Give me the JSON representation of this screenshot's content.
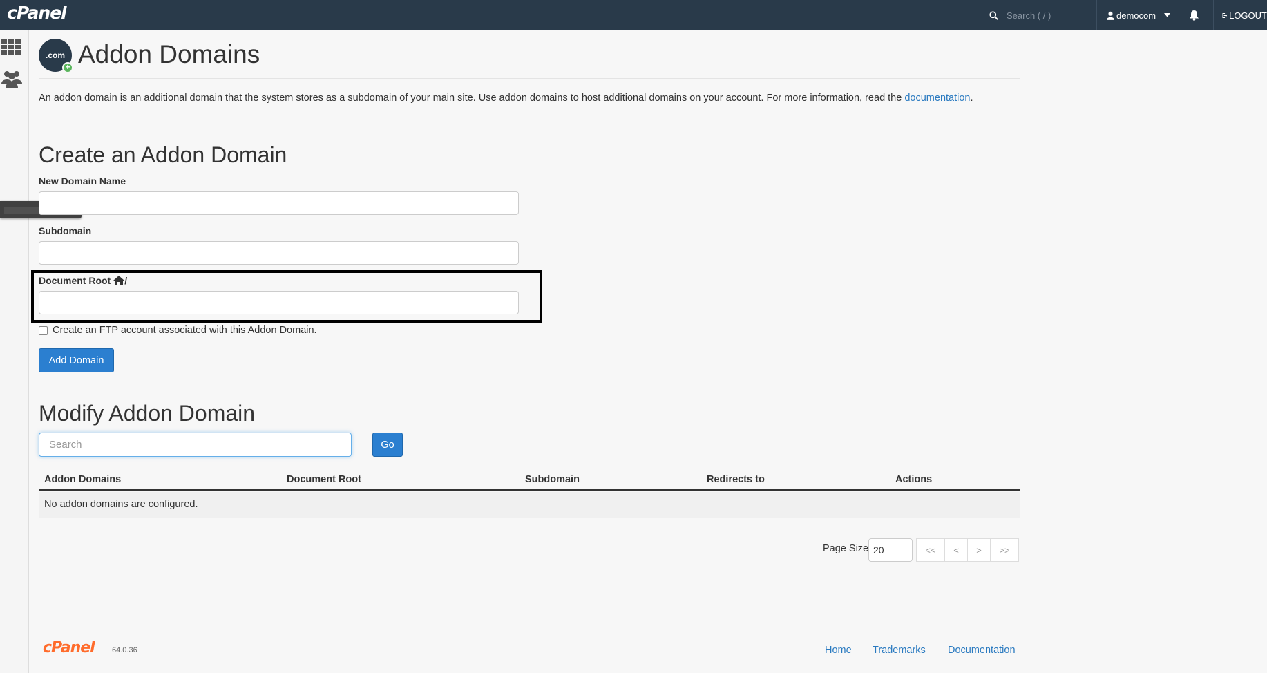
{
  "topbar": {
    "logo": "cPanel",
    "search_placeholder": "Search ( / )",
    "user": "democom",
    "logout": "LOGOUT"
  },
  "page": {
    "title": "Addon Domains",
    "icon_text": ".com",
    "intro": "An addon domain is an additional domain that the system stores as a subdomain of your main site. Use addon domains to host additional domains on your account. For more information, read the",
    "intro_link": "documentation",
    "intro_end": "."
  },
  "create": {
    "heading": "Create an Addon Domain",
    "new_domain_label": "New Domain Name",
    "new_domain_value": "",
    "subdomain_label": "Subdomain",
    "subdomain_value": "",
    "docroot_label": "Document Root",
    "docroot_suffix": "/",
    "docroot_value": "",
    "ftp_checkbox_label": "Create an FTP account associated with this Addon Domain.",
    "ftp_checked": false,
    "add_button": "Add Domain"
  },
  "modify": {
    "heading": "Modify Addon Domain",
    "search_placeholder": "Search",
    "go_button": "Go",
    "columns": [
      "Addon Domains",
      "Document Root",
      "Subdomain",
      "Redirects to",
      "Actions"
    ],
    "empty_message": "No addon domains are configured.",
    "page_size_label": "Page Size",
    "page_size_value": "20",
    "pager": [
      "<<",
      "<",
      ">",
      ">>"
    ]
  },
  "footer": {
    "logo": "cPanel",
    "version": "64.0.36",
    "links": [
      "Home",
      "Trademarks",
      "Documentation"
    ]
  },
  "colors": {
    "topbar": "#293a4a",
    "primary_button": "#2b7fd0",
    "link": "#2a7ac0",
    "footer_logo": "#ff6c2c"
  }
}
